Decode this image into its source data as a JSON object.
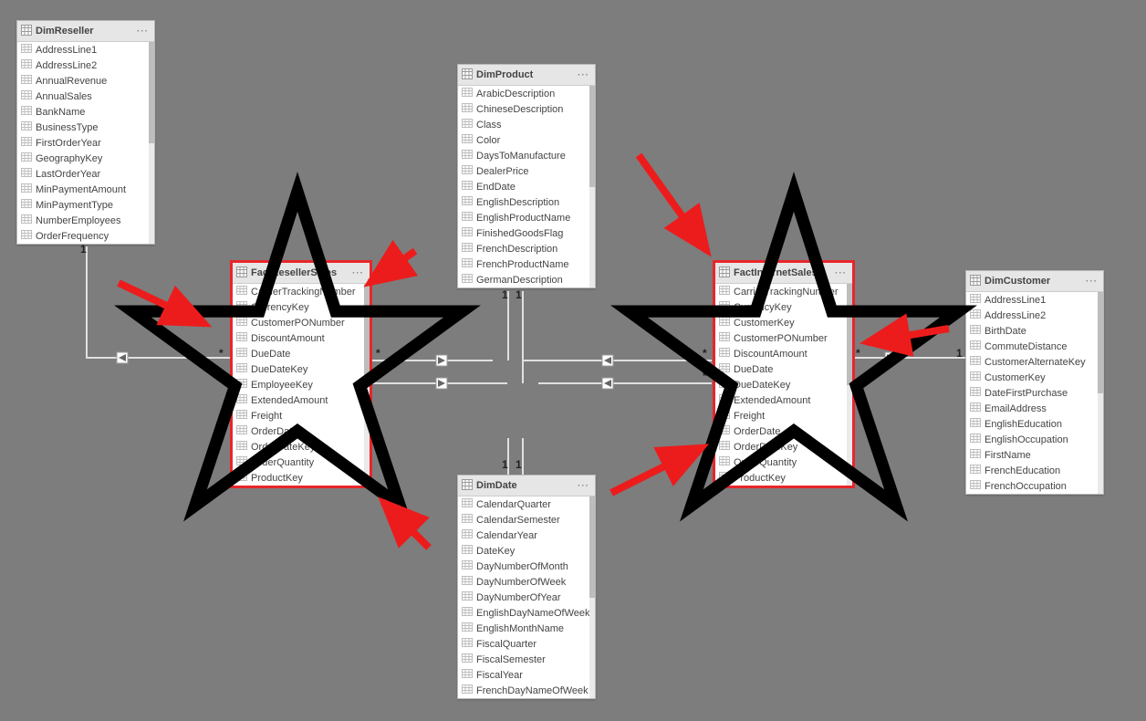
{
  "tables": {
    "dimReseller": {
      "title": "DimReseller",
      "fields": [
        "AddressLine1",
        "AddressLine2",
        "AnnualRevenue",
        "AnnualSales",
        "BankName",
        "BusinessType",
        "FirstOrderYear",
        "GeographyKey",
        "LastOrderYear",
        "MinPaymentAmount",
        "MinPaymentType",
        "NumberEmployees",
        "OrderFrequency"
      ]
    },
    "factResellerSales": {
      "title": "FactResellerSales",
      "fields": [
        "CarrierTrackingNumber",
        "CurrencyKey",
        "CustomerPONumber",
        "DiscountAmount",
        "DueDate",
        "DueDateKey",
        "EmployeeKey",
        "ExtendedAmount",
        "Freight",
        "OrderDate",
        "OrderDateKey",
        "OrderQuantity",
        "ProductKey"
      ]
    },
    "dimProduct": {
      "title": "DimProduct",
      "fields": [
        "ArabicDescription",
        "ChineseDescription",
        "Class",
        "Color",
        "DaysToManufacture",
        "DealerPrice",
        "EndDate",
        "EnglishDescription",
        "EnglishProductName",
        "FinishedGoodsFlag",
        "FrenchDescription",
        "FrenchProductName",
        "GermanDescription"
      ]
    },
    "factInternetSales": {
      "title": "FactInternetSales",
      "fields": [
        "CarrierTrackingNumber",
        "CurrencyKey",
        "CustomerKey",
        "CustomerPONumber",
        "DiscountAmount",
        "DueDate",
        "DueDateKey",
        "ExtendedAmount",
        "Freight",
        "OrderDate",
        "OrderDateKey",
        "OrderQuantity",
        "ProductKey"
      ]
    },
    "dimCustomer": {
      "title": "DimCustomer",
      "fields": [
        "AddressLine1",
        "AddressLine2",
        "BirthDate",
        "CommuteDistance",
        "CustomerAlternateKey",
        "CustomerKey",
        "DateFirstPurchase",
        "EmailAddress",
        "EnglishEducation",
        "EnglishOccupation",
        "FirstName",
        "FrenchEducation",
        "FrenchOccupation"
      ]
    },
    "dimDate": {
      "title": "DimDate",
      "fields": [
        "CalendarQuarter",
        "CalendarSemester",
        "CalendarYear",
        "DateKey",
        "DayNumberOfMonth",
        "DayNumberOfWeek",
        "DayNumberOfYear",
        "EnglishDayNameOfWeek",
        "EnglishMonthName",
        "FiscalQuarter",
        "FiscalSemester",
        "FiscalYear",
        "FrenchDayNameOfWeek"
      ]
    }
  },
  "relationships": [
    {
      "from": "DimReseller",
      "to": "FactResellerSales",
      "fromCard": "1",
      "toCard": "*"
    },
    {
      "from": "DimProduct",
      "to": "FactResellerSales",
      "fromCard": "1",
      "toCard": "*"
    },
    {
      "from": "DimProduct",
      "to": "FactInternetSales",
      "fromCard": "1",
      "toCard": "*"
    },
    {
      "from": "DimDate",
      "to": "FactResellerSales",
      "fromCard": "1",
      "toCard": "*"
    },
    {
      "from": "DimDate",
      "to": "FactInternetSales",
      "fromCard": "1",
      "toCard": "*"
    },
    {
      "from": "DimCustomer",
      "to": "FactInternetSales",
      "fromCard": "1",
      "toCard": "*"
    }
  ],
  "cardinality": {
    "one": "1",
    "many": "*"
  },
  "annotations": {
    "starsOn": [
      "FactResellerSales",
      "FactInternetSales"
    ],
    "redArrowsPointTo": [
      "FactResellerSales",
      "FactInternetSales"
    ]
  }
}
